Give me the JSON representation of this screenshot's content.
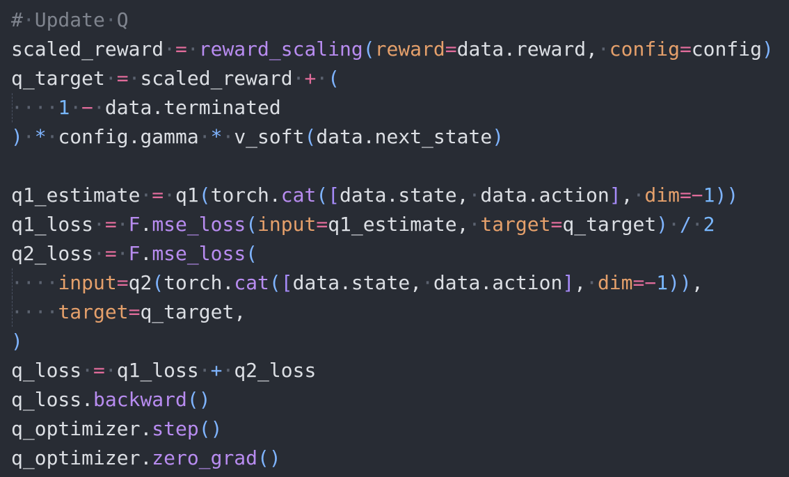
{
  "editor": {
    "colors": {
      "background": "#282c34",
      "text": "#dcdfe4",
      "comment": "#7f848e",
      "operator": "#e06c9a",
      "function": "#b88cf0",
      "parameter": "#e5a06b",
      "number": "#79b8ff",
      "paren": "#7fb4ff",
      "whitespace_dot": "#5c6370"
    },
    "lines": [
      {
        "guide": false,
        "tokens": [
          {
            "t": "#",
            "c": "comment"
          },
          {
            "t": "·",
            "c": "ws"
          },
          {
            "t": "Update",
            "c": "comment"
          },
          {
            "t": "·",
            "c": "ws"
          },
          {
            "t": "Q",
            "c": "comment"
          }
        ]
      },
      {
        "guide": false,
        "tokens": [
          {
            "t": "scaled_reward",
            "c": "var"
          },
          {
            "t": "·",
            "c": "ws"
          },
          {
            "t": "=",
            "c": "op"
          },
          {
            "t": "·",
            "c": "ws"
          },
          {
            "t": "reward_scaling",
            "c": "fn"
          },
          {
            "t": "(",
            "c": "paren"
          },
          {
            "t": "reward",
            "c": "param"
          },
          {
            "t": "=",
            "c": "op"
          },
          {
            "t": "data.reward,",
            "c": "var"
          },
          {
            "t": "·",
            "c": "ws"
          },
          {
            "t": "config",
            "c": "param"
          },
          {
            "t": "=",
            "c": "op"
          },
          {
            "t": "config",
            "c": "var"
          },
          {
            "t": ")",
            "c": "paren"
          }
        ]
      },
      {
        "guide": false,
        "tokens": [
          {
            "t": "q_target",
            "c": "var"
          },
          {
            "t": "·",
            "c": "ws"
          },
          {
            "t": "=",
            "c": "op"
          },
          {
            "t": "·",
            "c": "ws"
          },
          {
            "t": "scaled_reward",
            "c": "var"
          },
          {
            "t": "·",
            "c": "ws"
          },
          {
            "t": "+",
            "c": "op"
          },
          {
            "t": "·",
            "c": "ws"
          },
          {
            "t": "(",
            "c": "paren"
          }
        ]
      },
      {
        "guide": true,
        "tokens": [
          {
            "t": "····",
            "c": "ws"
          },
          {
            "t": "1",
            "c": "num"
          },
          {
            "t": "·",
            "c": "ws"
          },
          {
            "t": "−",
            "c": "op"
          },
          {
            "t": "·",
            "c": "ws"
          },
          {
            "t": "data.terminated",
            "c": "var"
          }
        ]
      },
      {
        "guide": false,
        "tokens": [
          {
            "t": ")",
            "c": "paren"
          },
          {
            "t": "·",
            "c": "ws"
          },
          {
            "t": "*",
            "c": "op-mul"
          },
          {
            "t": "·",
            "c": "ws"
          },
          {
            "t": "config.gamma",
            "c": "var"
          },
          {
            "t": "·",
            "c": "ws"
          },
          {
            "t": "*",
            "c": "op-mul"
          },
          {
            "t": "·",
            "c": "ws"
          },
          {
            "t": "v_soft",
            "c": "var"
          },
          {
            "t": "(",
            "c": "paren"
          },
          {
            "t": "data.next_state",
            "c": "var"
          },
          {
            "t": ")",
            "c": "paren"
          }
        ]
      },
      {
        "guide": false,
        "tokens": []
      },
      {
        "guide": false,
        "tokens": [
          {
            "t": "q1_estimate",
            "c": "var"
          },
          {
            "t": "·",
            "c": "ws"
          },
          {
            "t": "=",
            "c": "op"
          },
          {
            "t": "·",
            "c": "ws"
          },
          {
            "t": "q1",
            "c": "var"
          },
          {
            "t": "(",
            "c": "paren"
          },
          {
            "t": "torch",
            "c": "var"
          },
          {
            "t": ".",
            "c": "punct"
          },
          {
            "t": "cat",
            "c": "fn"
          },
          {
            "t": "(",
            "c": "paren"
          },
          {
            "t": "[",
            "c": "bracket"
          },
          {
            "t": "data.state,",
            "c": "var"
          },
          {
            "t": "·",
            "c": "ws"
          },
          {
            "t": "data.action",
            "c": "var"
          },
          {
            "t": "]",
            "c": "bracket"
          },
          {
            "t": ",",
            "c": "punct"
          },
          {
            "t": "·",
            "c": "ws"
          },
          {
            "t": "dim",
            "c": "param"
          },
          {
            "t": "=",
            "c": "op"
          },
          {
            "t": "−",
            "c": "op"
          },
          {
            "t": "1",
            "c": "num"
          },
          {
            "t": "))",
            "c": "paren"
          }
        ]
      },
      {
        "guide": false,
        "tokens": [
          {
            "t": "q1_loss",
            "c": "var"
          },
          {
            "t": "·",
            "c": "ws"
          },
          {
            "t": "=",
            "c": "op"
          },
          {
            "t": "·",
            "c": "ws"
          },
          {
            "t": "F",
            "c": "fn"
          },
          {
            "t": ".",
            "c": "punct"
          },
          {
            "t": "mse_loss",
            "c": "fn"
          },
          {
            "t": "(",
            "c": "paren"
          },
          {
            "t": "input",
            "c": "param"
          },
          {
            "t": "=",
            "c": "op"
          },
          {
            "t": "q1_estimate,",
            "c": "var"
          },
          {
            "t": "·",
            "c": "ws"
          },
          {
            "t": "target",
            "c": "param"
          },
          {
            "t": "=",
            "c": "op"
          },
          {
            "t": "q_target",
            "c": "var"
          },
          {
            "t": ")",
            "c": "paren"
          },
          {
            "t": "·",
            "c": "ws"
          },
          {
            "t": "/",
            "c": "op-mul"
          },
          {
            "t": "·",
            "c": "ws"
          },
          {
            "t": "2",
            "c": "num"
          }
        ]
      },
      {
        "guide": false,
        "tokens": [
          {
            "t": "q2_loss",
            "c": "var"
          },
          {
            "t": "·",
            "c": "ws"
          },
          {
            "t": "=",
            "c": "op"
          },
          {
            "t": "·",
            "c": "ws"
          },
          {
            "t": "F",
            "c": "fn"
          },
          {
            "t": ".",
            "c": "punct"
          },
          {
            "t": "mse_loss",
            "c": "fn"
          },
          {
            "t": "(",
            "c": "paren"
          }
        ]
      },
      {
        "guide": true,
        "tokens": [
          {
            "t": "····",
            "c": "ws"
          },
          {
            "t": "input",
            "c": "param"
          },
          {
            "t": "=",
            "c": "op"
          },
          {
            "t": "q2",
            "c": "var"
          },
          {
            "t": "(",
            "c": "paren"
          },
          {
            "t": "torch",
            "c": "var"
          },
          {
            "t": ".",
            "c": "punct"
          },
          {
            "t": "cat",
            "c": "fn"
          },
          {
            "t": "(",
            "c": "paren"
          },
          {
            "t": "[",
            "c": "bracket"
          },
          {
            "t": "data.state,",
            "c": "var"
          },
          {
            "t": "·",
            "c": "ws"
          },
          {
            "t": "data.action",
            "c": "var"
          },
          {
            "t": "]",
            "c": "bracket"
          },
          {
            "t": ",",
            "c": "punct"
          },
          {
            "t": "·",
            "c": "ws"
          },
          {
            "t": "dim",
            "c": "param"
          },
          {
            "t": "=",
            "c": "op"
          },
          {
            "t": "−",
            "c": "op"
          },
          {
            "t": "1",
            "c": "num"
          },
          {
            "t": "))",
            "c": "paren"
          },
          {
            "t": ",",
            "c": "punct"
          }
        ]
      },
      {
        "guide": true,
        "tokens": [
          {
            "t": "····",
            "c": "ws"
          },
          {
            "t": "target",
            "c": "param"
          },
          {
            "t": "=",
            "c": "op"
          },
          {
            "t": "q_target,",
            "c": "var"
          }
        ]
      },
      {
        "guide": false,
        "tokens": [
          {
            "t": ")",
            "c": "paren"
          }
        ]
      },
      {
        "guide": false,
        "tokens": [
          {
            "t": "q_loss",
            "c": "var"
          },
          {
            "t": "·",
            "c": "ws"
          },
          {
            "t": "=",
            "c": "op"
          },
          {
            "t": "·",
            "c": "ws"
          },
          {
            "t": "q1_loss",
            "c": "var"
          },
          {
            "t": "·",
            "c": "ws"
          },
          {
            "t": "+",
            "c": "op-mul"
          },
          {
            "t": "·",
            "c": "ws"
          },
          {
            "t": "q2_loss",
            "c": "var"
          }
        ]
      },
      {
        "guide": false,
        "tokens": [
          {
            "t": "q_loss",
            "c": "var"
          },
          {
            "t": ".",
            "c": "punct"
          },
          {
            "t": "backward",
            "c": "fn"
          },
          {
            "t": "()",
            "c": "paren"
          }
        ]
      },
      {
        "guide": false,
        "tokens": [
          {
            "t": "q_optimizer",
            "c": "var"
          },
          {
            "t": ".",
            "c": "punct"
          },
          {
            "t": "step",
            "c": "fn"
          },
          {
            "t": "()",
            "c": "paren"
          }
        ]
      },
      {
        "guide": false,
        "tokens": [
          {
            "t": "q_optimizer",
            "c": "var"
          },
          {
            "t": ".",
            "c": "punct"
          },
          {
            "t": "zero_grad",
            "c": "fn"
          },
          {
            "t": "()",
            "c": "paren"
          }
        ]
      }
    ]
  }
}
